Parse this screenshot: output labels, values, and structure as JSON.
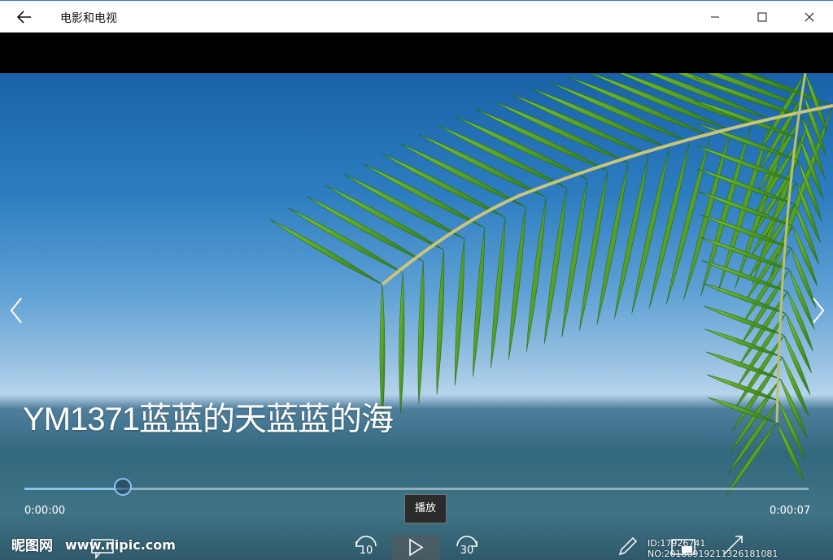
{
  "window": {
    "title": "电影和电视"
  },
  "player": {
    "video_title": "YM1371蓝蓝的天蓝蓝的海",
    "current_time": "0:00:00",
    "total_time": "0:00:07",
    "progress": 0.125,
    "tooltip": "播放",
    "skip_back_label": "10",
    "skip_forward_label": "30"
  },
  "watermark": {
    "logo_text": "昵图网",
    "site": "www.nipic.com",
    "id": "ID:17926741 NO:20180919211326181081"
  },
  "icons": {
    "back": "arrow-left-icon",
    "minimize": "minimize-icon",
    "maximize": "maximize-icon",
    "close": "close-icon",
    "prev": "chevron-left-icon",
    "next": "chevron-right-icon",
    "play": "play-icon",
    "skip_back": "rewind-10-icon",
    "skip_forward": "forward-30-icon",
    "subtitles": "subtitles-icon",
    "edit": "pen-icon",
    "mini_view": "mini-view-icon",
    "fullscreen": "fullscreen-icon"
  },
  "colors": {
    "accent": "#8cc4f2",
    "titlebar_border": "#2b79d0"
  }
}
